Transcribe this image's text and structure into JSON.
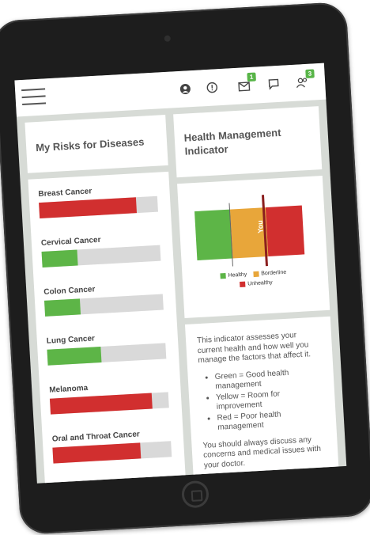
{
  "nav": {
    "badges": {
      "inbox": "1",
      "people": "3"
    }
  },
  "risks_card": {
    "title": "My Risks for Diseases",
    "items": [
      {
        "label": "Breast Cancer",
        "level": 0.82,
        "status": "unhealthy"
      },
      {
        "label": "Cervical Cancer",
        "level": 0.3,
        "status": "healthy"
      },
      {
        "label": "Colon Cancer",
        "level": 0.3,
        "status": "healthy"
      },
      {
        "label": "Lung Cancer",
        "level": 0.45,
        "status": "healthy"
      },
      {
        "label": "Melanoma",
        "level": 0.86,
        "status": "unhealthy"
      },
      {
        "label": "Oral and Throat Cancer",
        "level": 0.74,
        "status": "unhealthy"
      }
    ]
  },
  "indicator_card": {
    "title": "Health Management Indicator",
    "chart": {
      "marker_label": "You",
      "segments": [
        "healthy",
        "borderline",
        "unhealthy"
      ],
      "legend": {
        "healthy": "Healthy",
        "borderline": "Borderline",
        "unhealthy": "Unhealthy"
      }
    }
  },
  "info_card": {
    "intro": "This indicator assesses your current health and how well you manage the factors that affect it.",
    "bullets": [
      "Green = Good health management",
      "Yellow = Room for improvement",
      "Red = Poor health management"
    ],
    "outro": "You should always discuss any concerns and medical issues with your doctor."
  },
  "colors": {
    "healthy": "#5db547",
    "borderline": "#e8a63a",
    "unhealthy": "#d12f2f",
    "track": "#d9d9d9"
  }
}
